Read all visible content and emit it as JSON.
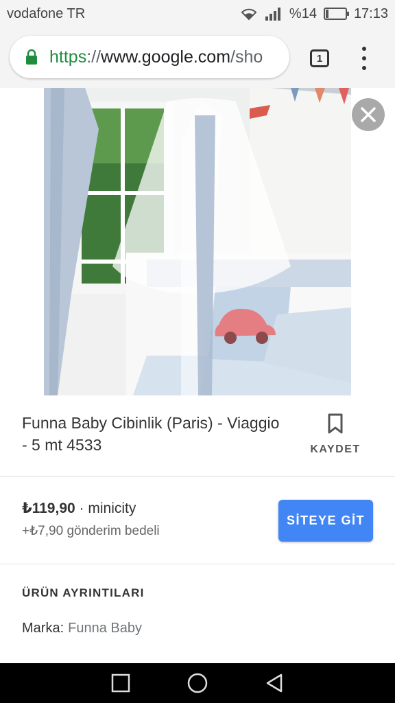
{
  "status_bar": {
    "carrier": "vodafone TR",
    "battery": "%14",
    "battery_level": 0.14,
    "time": "17:13"
  },
  "browser": {
    "url_scheme": "https",
    "url_sep": "://",
    "url_host": "www.google.com",
    "url_rest": "/sho",
    "tab_count": "1"
  },
  "product": {
    "title": "Funna Baby Cibinlik (Paris) - Viaggio - 5 mt 4533",
    "save_label": "KAYDET",
    "price": "₺119,90",
    "seller": " · minicity",
    "shipping": "+₺7,90 gönderim bedeli",
    "visit_button": "SİTEYE GİT"
  },
  "details": {
    "heading": "ÜRÜN AYRINTILARI",
    "brand_label": "Marka:",
    "brand_value": "Funna Baby"
  },
  "icons": {
    "lock": "lock-icon",
    "close": "close-icon",
    "bookmark": "bookmark-icon",
    "menu": "more-vert-icon"
  },
  "colors": {
    "accent": "#4285f4",
    "secure": "#1e8e3e"
  }
}
